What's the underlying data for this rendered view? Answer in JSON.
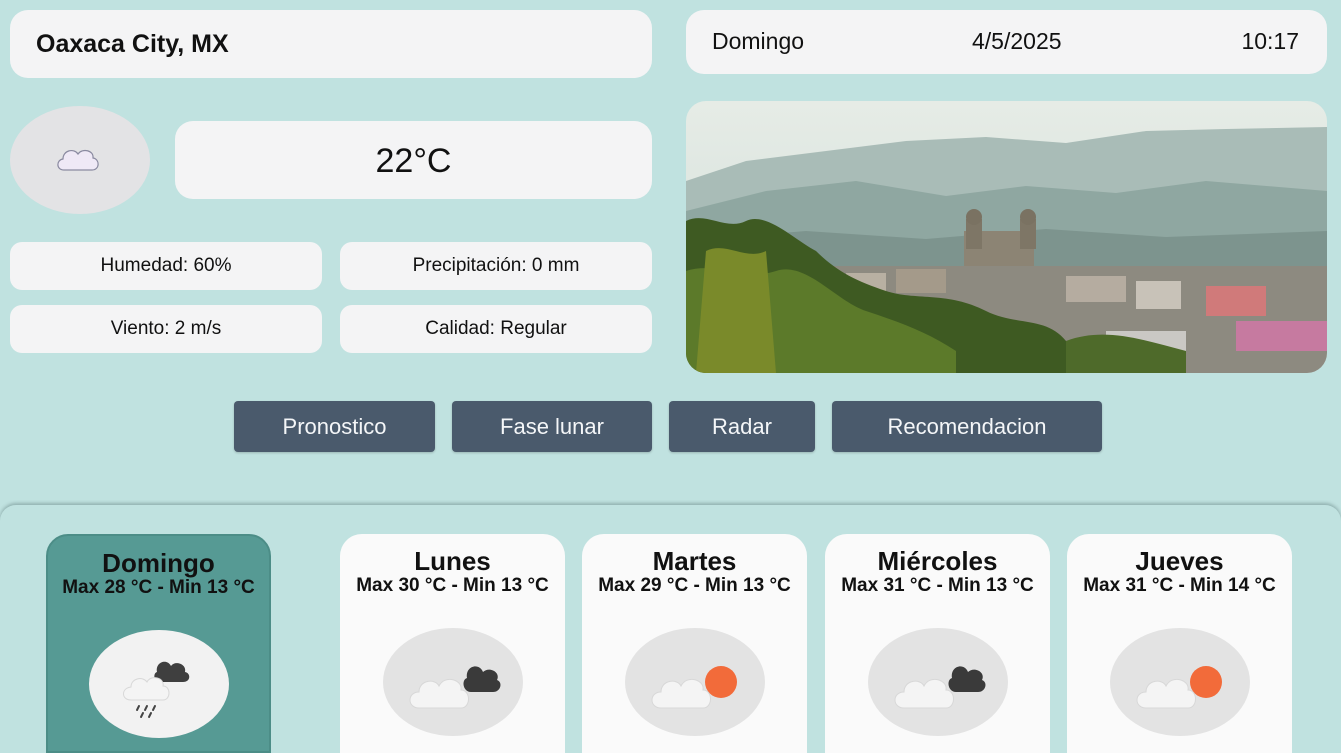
{
  "location": {
    "city": "Oaxaca City, MX"
  },
  "datetime": {
    "day": "Domingo",
    "date": "4/5/2025",
    "time": "10:17"
  },
  "current": {
    "icon": "cloud-icon",
    "temperature": "22°C",
    "humidity": "Humedad: 60%",
    "precipitation": "Precipitación: 0 mm",
    "wind": "Viento: 2 m/s",
    "air_quality": "Calidad: Regular"
  },
  "photo": {
    "icon": "city-landscape-photo"
  },
  "nav": {
    "forecast": "Pronostico",
    "moon_phase": "Fase lunar",
    "radar": "Radar",
    "recommendation": "Recomendacion"
  },
  "forecast": [
    {
      "day": "Domingo",
      "temps": "Max 28 °C - Min 13 °C",
      "icon": "rain-cloud-icon"
    },
    {
      "day": "Lunes",
      "temps": "Max 30 °C - Min 13 °C",
      "icon": "dark-cloud-icon"
    },
    {
      "day": "Martes",
      "temps": "Max 29 °C - Min 13 °C",
      "icon": "partly-sunny-icon"
    },
    {
      "day": "Miércoles",
      "temps": "Max 31 °C - Min 13 °C",
      "icon": "dark-cloud-icon"
    },
    {
      "day": "Jueves",
      "temps": "Max 31 °C - Min 14 °C",
      "icon": "partly-sunny-icon"
    }
  ],
  "colors": {
    "background": "#c0e2e0",
    "panel": "#f4f4f5",
    "button": "#4a5a6c",
    "active_card": "#569a94",
    "sun": "#f26b3a"
  }
}
